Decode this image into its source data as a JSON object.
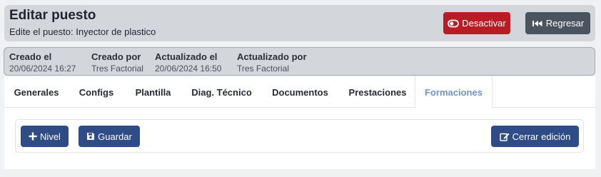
{
  "header": {
    "title": "Editar puesto",
    "subtitle": "Edite el puesto: Inyector de plastico",
    "deactivate_label": "Desactivar",
    "back_label": "Regresar"
  },
  "meta": [
    {
      "label": "Creado el",
      "value": "20/06/2024 16:27"
    },
    {
      "label": "Creado por",
      "value": "Tres Factorial"
    },
    {
      "label": "Actualizado el",
      "value": "20/06/2024 16:50"
    },
    {
      "label": "Actualizado por",
      "value": "Tres Factorial"
    }
  ],
  "tabs": [
    {
      "label": "Generales"
    },
    {
      "label": "Configs"
    },
    {
      "label": "Plantilla"
    },
    {
      "label": "Diag. Técnico"
    },
    {
      "label": "Documentos"
    },
    {
      "label": "Prestaciones"
    },
    {
      "label": "Formaciones",
      "active": true
    }
  ],
  "toolbar": {
    "level_label": "Nivel",
    "save_label": "Guardar",
    "close_edit_label": "Cerrar edición"
  },
  "colors": {
    "danger": "#b91c24",
    "secondary": "#4a5461",
    "primary": "#2f4c86",
    "active_tab": "#6f93c9"
  },
  "icons": {
    "deactivate": "toggle-off-icon",
    "back": "backward-icon",
    "level": "plus-icon",
    "save": "save-icon",
    "close_edit": "edit-icon"
  }
}
